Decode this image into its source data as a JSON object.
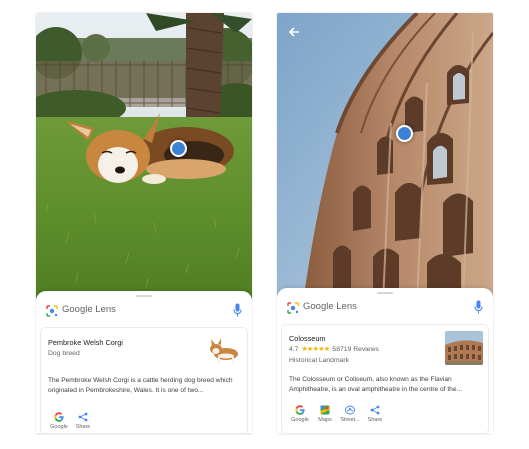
{
  "left": {
    "lens_title": "Google Lens",
    "result": {
      "title": "Pembroke Welsh Corgi",
      "subtitle": "Dog breed",
      "description": "The Pembroke Welsh Corgi is a cattle herding dog breed which originated in Pembrokeshire, Wales. It is one of two..."
    },
    "actions": [
      {
        "label": "Google",
        "icon": "google-icon"
      },
      {
        "label": "Share",
        "icon": "share-icon"
      }
    ]
  },
  "right": {
    "lens_title": "Google Lens",
    "result": {
      "title": "Colosseum",
      "rating_value": "4.7",
      "stars": "★★★★★",
      "reviews": "58719 Reviews",
      "subtitle": "Historical Landmark",
      "description": "The Colosseum or Coliseum, also known as the Flavian Amphitheatre, is an oval amphitheatre in the centre of the..."
    },
    "actions": [
      {
        "label": "Google",
        "icon": "google-icon"
      },
      {
        "label": "Maps",
        "icon": "maps-icon"
      },
      {
        "label": "Street...",
        "icon": "street-view-icon"
      },
      {
        "label": "Share",
        "icon": "share-icon"
      }
    ]
  },
  "colors": {
    "focus_dot": "#3b82d6",
    "star": "#f4b400",
    "google_blue": "#4285f4",
    "google_red": "#ea4335",
    "google_yellow": "#fbbc05",
    "google_green": "#34a853"
  }
}
